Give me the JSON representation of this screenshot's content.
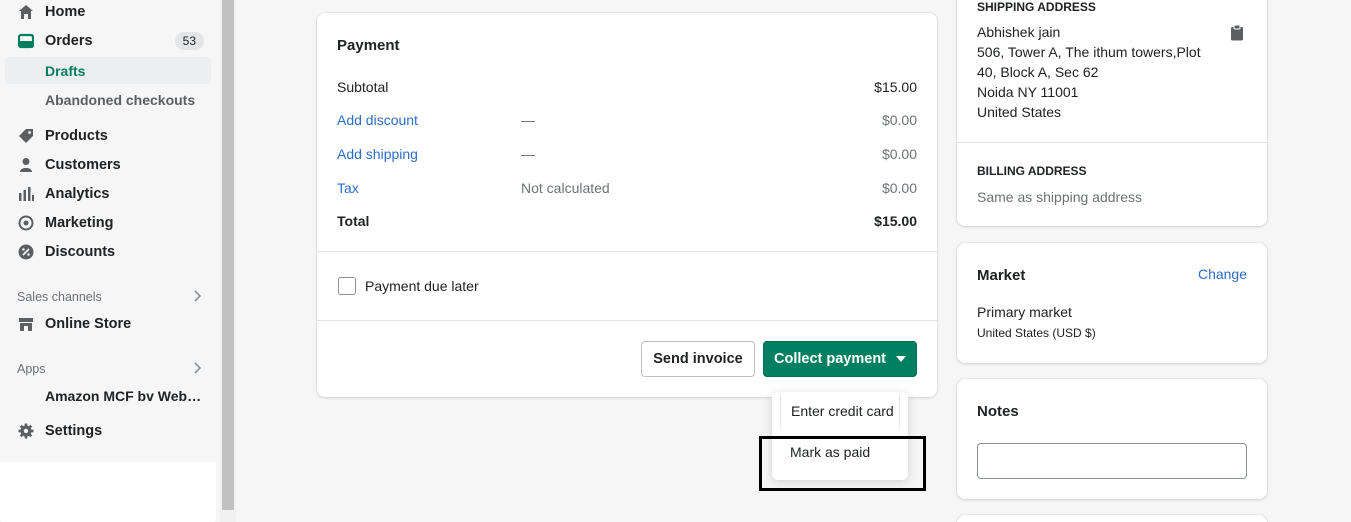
{
  "sidebar": {
    "items": [
      {
        "label": "Home",
        "icon": "home-icon"
      },
      {
        "label": "Orders",
        "icon": "orders-icon",
        "badge": "53"
      },
      {
        "label": "Drafts"
      },
      {
        "label": "Abandoned checkouts"
      },
      {
        "label": "Products",
        "icon": "tag-icon"
      },
      {
        "label": "Customers",
        "icon": "person-icon"
      },
      {
        "label": "Analytics",
        "icon": "bar-chart-icon"
      },
      {
        "label": "Marketing",
        "icon": "target-icon"
      },
      {
        "label": "Discounts",
        "icon": "discount-icon"
      }
    ],
    "sales_channels_label": "Sales channels",
    "online_store": "Online Store",
    "apps_label": "Apps",
    "amazon_app": "Amazon MCF bv Web…",
    "settings": "Settings"
  },
  "payment": {
    "title": "Payment",
    "subtotal_label": "Subtotal",
    "subtotal_value": "$15.00",
    "discount_label": "Add discount",
    "discount_mid": "—",
    "discount_value": "$0.00",
    "shipping_label": "Add shipping",
    "shipping_mid": "—",
    "shipping_value": "$0.00",
    "tax_label": "Tax",
    "tax_mid": "Not calculated",
    "tax_value": "$0.00",
    "total_label": "Total",
    "total_value": "$15.00",
    "due_later_label": "Payment due later",
    "send_invoice": "Send invoice",
    "collect_payment": "Collect payment",
    "dropdown": {
      "enter_card": "Enter credit card",
      "mark_paid": "Mark as paid"
    }
  },
  "customer": {
    "shipping_header": "SHIPPING ADDRESS",
    "name": "Abhishek jain",
    "line1": "506, Tower A, The ithum towers,Plot",
    "line2": "40, Block A, Sec 62",
    "line3": "Noida NY 11001",
    "country": "United States",
    "billing_header": "BILLING ADDRESS",
    "billing_value": "Same as shipping address"
  },
  "market": {
    "title": "Market",
    "change": "Change",
    "name": "Primary market",
    "detail": "United States (USD $)"
  },
  "notes": {
    "title": "Notes",
    "value": ""
  },
  "colors": {
    "primary": "#008060",
    "link": "#2c6ecb"
  }
}
